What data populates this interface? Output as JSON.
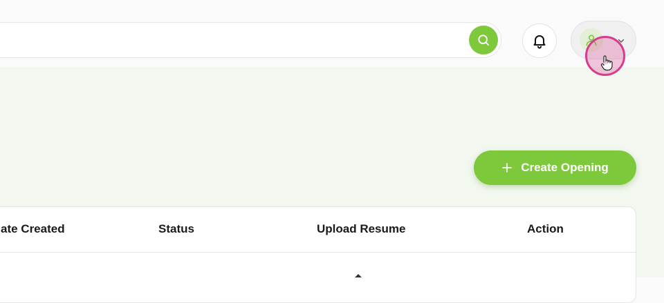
{
  "header": {
    "search": {
      "value": "",
      "placeholder": ""
    },
    "icons": {
      "search": "search-icon",
      "notifications": "bell-icon",
      "avatar": "user-icon",
      "menu": "chevron-down-icon"
    }
  },
  "main": {
    "create_button": {
      "label": "Create Opening",
      "icon": "plus-icon"
    },
    "table": {
      "columns": [
        "ate Created",
        "Status",
        "Upload Resume",
        "Action"
      ]
    }
  },
  "colors": {
    "accent": "#7ec93b",
    "content_bg": "#f2f7ef",
    "cursor_ring": "#d83b8c"
  }
}
